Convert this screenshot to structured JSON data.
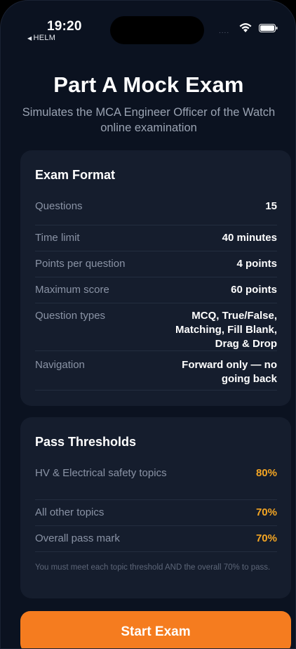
{
  "status_bar": {
    "time": "19:20",
    "back_app": "HELM",
    "signal": "....",
    "wifi_icon": "wifi-icon",
    "battery_icon": "battery-icon"
  },
  "header": {
    "title": "Part A Mock Exam",
    "subtitle": "Simulates the MCA Engineer Officer of the Watch online examination"
  },
  "exam_format": {
    "title": "Exam Format",
    "rows": [
      {
        "label": "Questions",
        "value": "15"
      },
      {
        "label": "Time limit",
        "value": "40 minutes"
      },
      {
        "label": "Points per question",
        "value": "4 points"
      },
      {
        "label": "Maximum score",
        "value": "60 points"
      },
      {
        "label": "Question types",
        "value": "MCQ, True/False, Matching, Fill Blank, Drag & Drop"
      },
      {
        "label": "Navigation",
        "value": "Forward only — no going back"
      }
    ]
  },
  "pass_thresholds": {
    "title": "Pass Thresholds",
    "rows": [
      {
        "label": "HV & Electrical safety topics",
        "value": "80%"
      },
      {
        "label": "All other topics",
        "value": "70%"
      },
      {
        "label": "Overall pass mark",
        "value": "70%"
      }
    ],
    "note": "You must meet each topic threshold AND the overall 70% to pass."
  },
  "actions": {
    "start_label": "Start Exam"
  },
  "colors": {
    "background": "#0b1220",
    "card": "#151d2d",
    "accent": "#f57c1f",
    "threshold": "#f5a623"
  }
}
